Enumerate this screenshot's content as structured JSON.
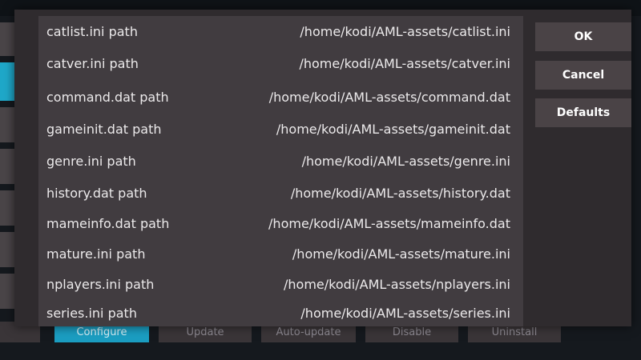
{
  "dialog": {
    "settings": [
      {
        "label": "catlist.ini path",
        "value": "/home/kodi/AML-assets/catlist.ini"
      },
      {
        "label": "catver.ini path",
        "value": "/home/kodi/AML-assets/catver.ini"
      },
      {
        "label": "command.dat path",
        "value": "/home/kodi/AML-assets/command.dat"
      },
      {
        "label": "gameinit.dat path",
        "value": "/home/kodi/AML-assets/gameinit.dat"
      },
      {
        "label": "genre.ini path",
        "value": "/home/kodi/AML-assets/genre.ini"
      },
      {
        "label": "history.dat path",
        "value": "/home/kodi/AML-assets/history.dat"
      },
      {
        "label": "mameinfo.dat path",
        "value": "/home/kodi/AML-assets/mameinfo.dat"
      },
      {
        "label": "mature.ini path",
        "value": "/home/kodi/AML-assets/mature.ini"
      },
      {
        "label": "nplayers.ini path",
        "value": "/home/kodi/AML-assets/nplayers.ini"
      },
      {
        "label": "series.ini path",
        "value": "/home/kodi/AML-assets/series.ini"
      }
    ],
    "buttons": {
      "ok": "OK",
      "cancel": "Cancel",
      "defaults": "Defaults"
    }
  },
  "background": {
    "bottom_buttons": [
      "Configure",
      "Update",
      "Auto-update",
      "Disable",
      "Uninstall"
    ]
  },
  "colors": {
    "accent": "#1b9dc1",
    "dialog_bg": "#2f2b2e",
    "list_bg": "#413c40",
    "button_bg": "#4a4346"
  }
}
